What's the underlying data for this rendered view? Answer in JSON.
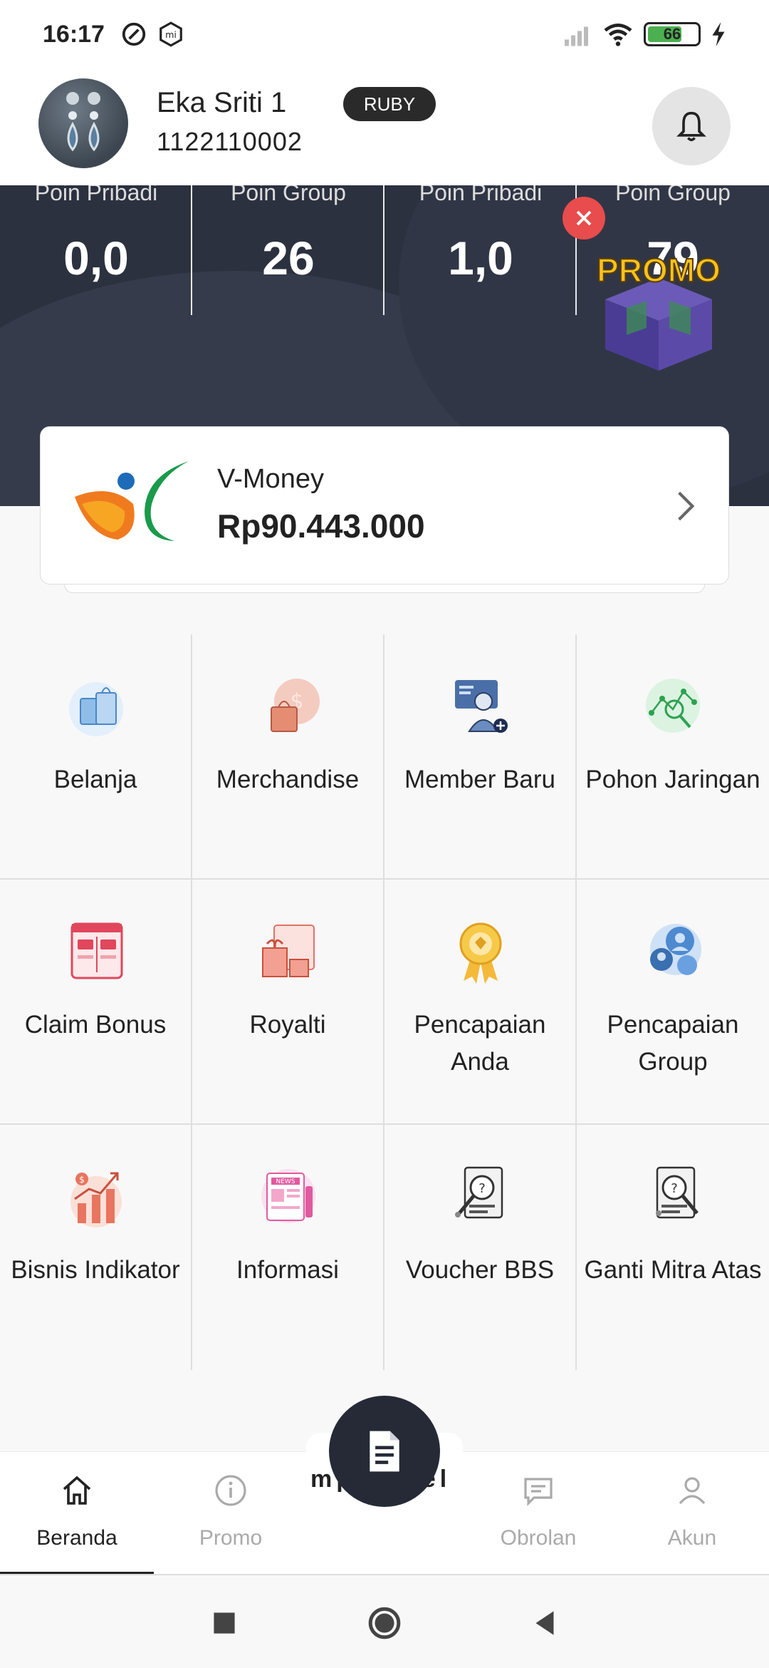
{
  "status_bar": {
    "time": "16:17",
    "battery": "66",
    "icons": [
      "do-not-disturb-icon",
      "mi-icon",
      "signal-icon",
      "wifi-icon",
      "battery-icon",
      "charging-icon"
    ]
  },
  "header": {
    "user_name": "Eka Sriti 1",
    "user_id": "1122110002",
    "rank_badge": "RUBY"
  },
  "points": [
    {
      "label": "Poin Pribadi",
      "value": "0,0"
    },
    {
      "label": "Poin Group",
      "value": "26"
    },
    {
      "label": "Poin Pribadi",
      "value": "1,0"
    },
    {
      "label": "Poin Group",
      "value": "79"
    }
  ],
  "promo": {
    "text": "PROMO"
  },
  "wallet": {
    "label": "V-Money",
    "amount": "Rp90.443.000"
  },
  "menu": [
    {
      "label": "Belanja",
      "icon": "shopping-bag-icon"
    },
    {
      "label": "Merchandise",
      "icon": "merchandise-icon"
    },
    {
      "label": "Member Baru",
      "icon": "new-member-icon"
    },
    {
      "label": "Pohon Jaringan",
      "icon": "network-tree-icon"
    },
    {
      "label": "Claim Bonus",
      "icon": "claim-bonus-icon"
    },
    {
      "label": "Royalti",
      "icon": "royalty-gift-icon"
    },
    {
      "label": "Pencapaian Anda",
      "icon": "achievement-medal-icon"
    },
    {
      "label": "Pencapaian Group",
      "icon": "group-achievement-icon"
    },
    {
      "label": "Bisnis Indikator",
      "icon": "business-indicator-icon"
    },
    {
      "label": "Informasi",
      "icon": "news-icon"
    },
    {
      "label": "Voucher BBS",
      "icon": "voucher-search-icon"
    },
    {
      "label": "Ganti Mitra Atas",
      "icon": "change-upline-icon"
    }
  ],
  "bottom_nav": {
    "items": [
      {
        "label": "Beranda",
        "icon": "home-icon",
        "active": true
      },
      {
        "label": "Promo",
        "icon": "info-icon",
        "active": false
      },
      {
        "label": "Obrolan",
        "icon": "chat-icon",
        "active": false
      },
      {
        "label": "Akun",
        "icon": "account-icon",
        "active": false
      }
    ],
    "fab_icon": "document-icon",
    "peek_text": "mpan bel"
  },
  "colors": {
    "banner_bg": "#2c3140",
    "fab_bg": "#252a36",
    "rank_badge_bg": "#2a2a2a",
    "close_red": "#e84c4c",
    "promo_yellow": "#f6c21c"
  }
}
